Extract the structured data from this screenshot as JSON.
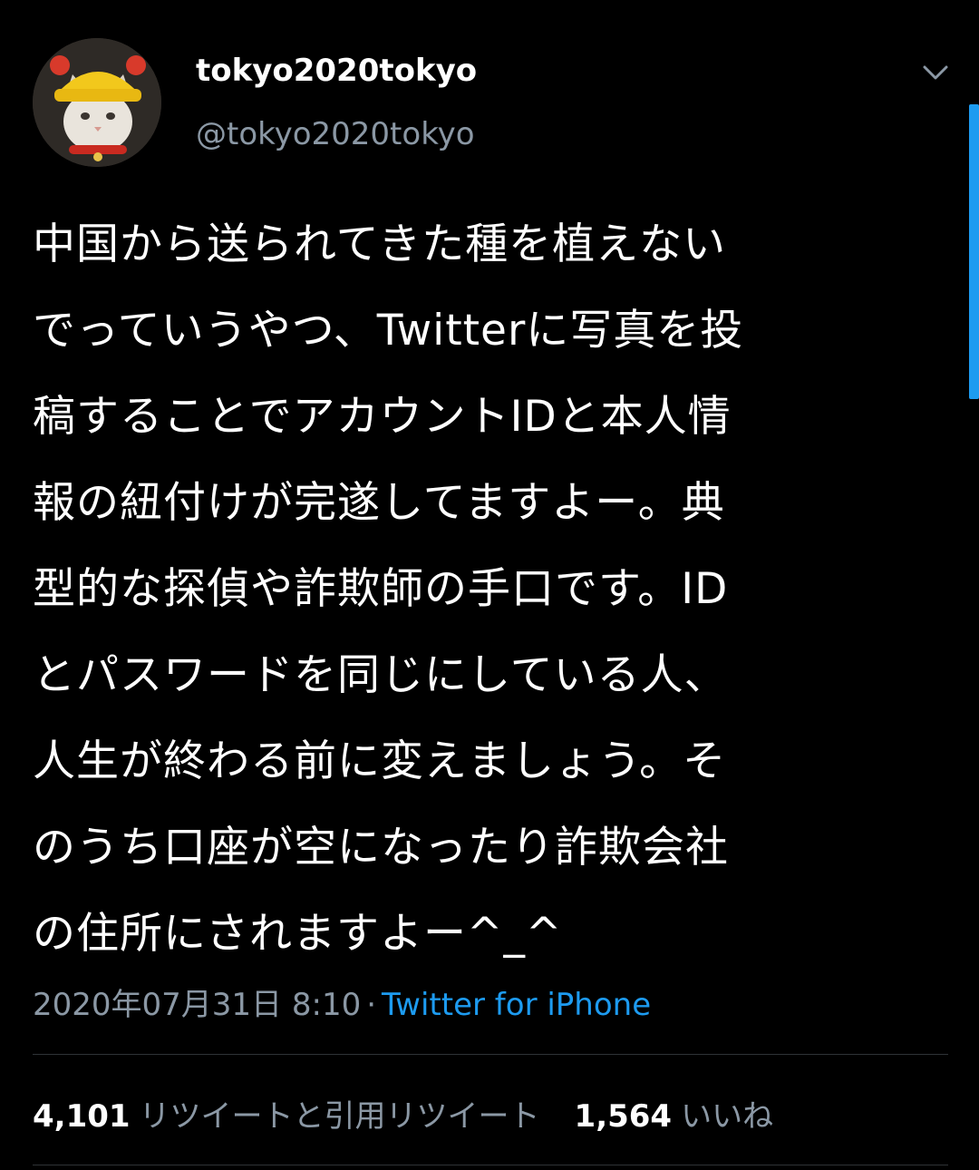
{
  "tweet": {
    "author": {
      "display_name": "tokyo2020tokyo",
      "handle": "@tokyo2020tokyo",
      "avatar_icon": "cat-with-yellow-hat-avatar"
    },
    "text_lines": [
      "中国から送られてきた種を植えない",
      "でっていうやつ、Twitterに写真を投",
      "稿することでアカウントIDと本人情",
      "報の紐付けが完遂してますよー。典",
      "型的な探偵や詐欺師の手口です。ID",
      "とパスワードを同じにしている人、",
      "人生が終わる前に変えましょう。そ",
      "のうち口座が空になったり詐欺会社",
      "の住所にされますよー^_^"
    ],
    "timestamp": "2020年07月31日 8:10",
    "separator": "·",
    "source": "Twitter for iPhone",
    "retweets_count": "4,101",
    "retweets_label": "リツイートと引用リツイート",
    "likes_count": "1,564",
    "likes_label": "いいね"
  },
  "colors": {
    "background": "#000000",
    "text_primary": "#ffffff",
    "text_secondary": "#8b98a5",
    "accent": "#1d9bf0",
    "divider": "#2f3336"
  }
}
